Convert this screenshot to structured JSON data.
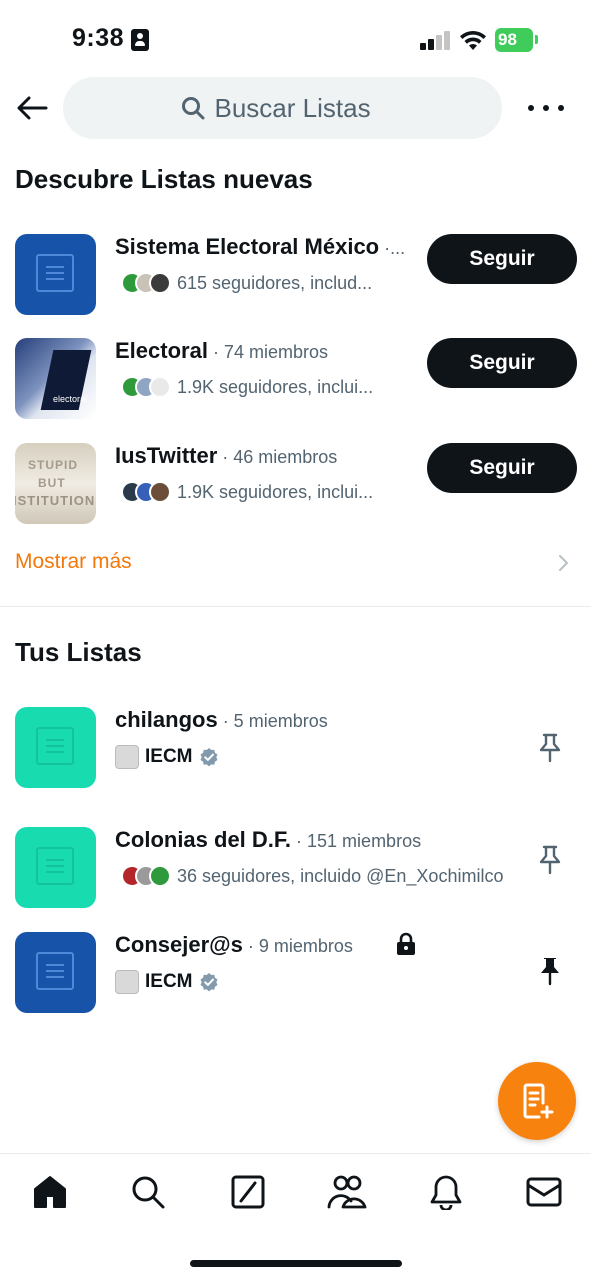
{
  "status_bar": {
    "time": "9:38",
    "battery": "98"
  },
  "header": {
    "search_placeholder": "Buscar Listas"
  },
  "discover": {
    "title": "Descubre Listas nuevas",
    "items": [
      {
        "name": "Sistema Electoral México",
        "meta": " ·...",
        "followers": "615 seguidores, includ...",
        "button": "Seguir"
      },
      {
        "name": "Electoral",
        "meta": " · 74 miembros",
        "followers": "1.9K seguidores, inclui...",
        "button": "Seguir",
        "thumb_caption": "electoral"
      },
      {
        "name": "IusTwitter",
        "meta": " · 46 miembros",
        "followers": "1.9K seguidores, inclui...",
        "button": "Seguir",
        "thumb_text": [
          "STUPID",
          "BUT",
          "ISTITUTION"
        ]
      }
    ],
    "show_more": "Mostrar más"
  },
  "your_lists": {
    "title": "Tus Listas",
    "items": [
      {
        "name": "chilangos",
        "meta": " · 5 miembros",
        "owner": "IECM",
        "pinned": false
      },
      {
        "name": "Colonias del D.F.",
        "meta": " · 151 miembros",
        "followers": "36 seguidores, incluido @En_Xochimilco",
        "pinned": false
      },
      {
        "name": "Consejer@s",
        "meta": " · 9 miembros",
        "owner": "IECM",
        "pinned": true,
        "private": true
      }
    ]
  },
  "colors": {
    "accent": "#f7820e",
    "text": "#0f1419",
    "secondary": "#536471",
    "list_blue": "#1753a8",
    "list_teal": "#19dbb0"
  },
  "tabs": [
    "home-icon",
    "search-icon",
    "grok-icon",
    "communities-icon",
    "notifications-icon",
    "messages-icon"
  ]
}
